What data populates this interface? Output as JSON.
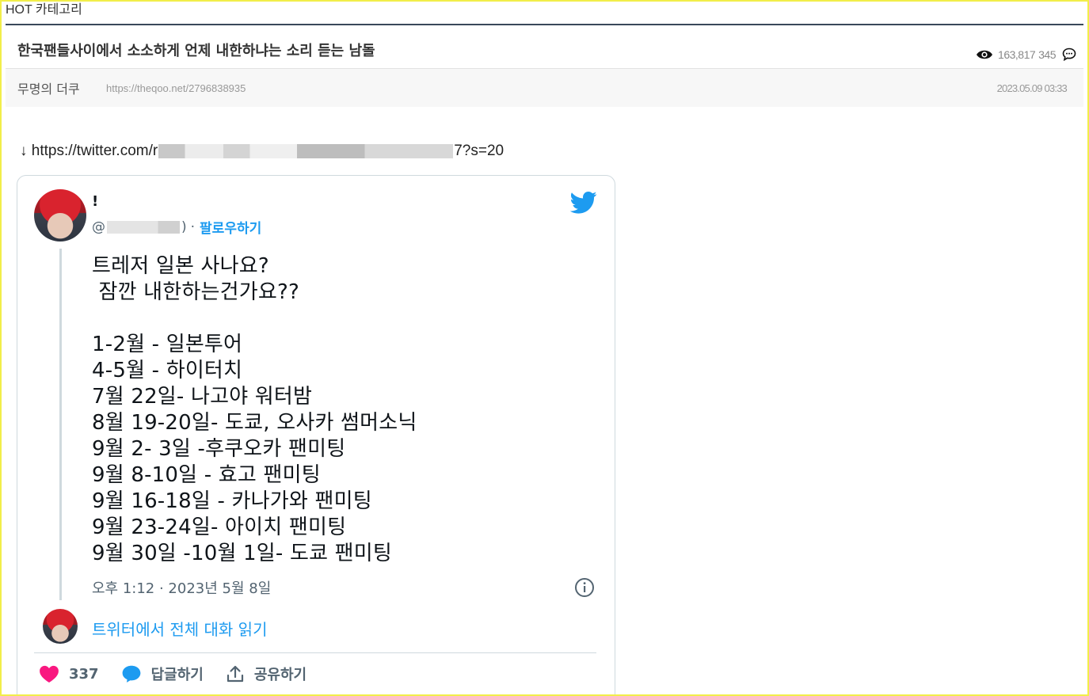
{
  "board": {
    "category": "HOT 카테고리",
    "post_title": "한국팬들사이에서 소소하게 언제 내한하냐는 소리 듣는 남돌",
    "views": "163,817",
    "comments": "345",
    "author": "무명의 더쿠",
    "post_url": "https://theqoo.net/2796838935",
    "date": "2023.05.09 03:33"
  },
  "source_link": {
    "prefix": "↓ https://twitter.com/r",
    "suffix": "7?s=20"
  },
  "tweet": {
    "display_name": "!",
    "handle_prefix": "@",
    "handle_suffix": ")",
    "separator": "·",
    "follow_label": "팔로우하기",
    "body": "트레저 일본 사나요?\n 잠깐 내한하는건가요??\n\n1-2월 - 일본투어\n4-5월 - 하이터치\n7월 22일- 나고야 워터밤\n8월 19-20일- 도쿄, 오사카 썸머소닉\n9월 2- 3일 -후쿠오카 팬미팅\n9월 8-10일 - 효고 팬미팅\n9월 16-18일 - 카나가와 팬미팅\n9월 23-24일- 아이치 팬미팅\n9월 30일 -10월 1일- 도쿄 팬미팅",
    "time": "오후 1:12 · 2023년 5월 8일",
    "read_conversation": "트위터에서 전체 대화 읽기",
    "like_count": "337",
    "reply_label": "답글하기",
    "share_label": "공유하기"
  },
  "colors": {
    "twitter_blue": "#1d9bf0",
    "like_pink": "#f91880",
    "frame_yellow": "#f2ee4a",
    "header_rule": "#39495a"
  },
  "icons": [
    "eye-icon",
    "comment-icon",
    "twitter-bird-icon",
    "info-icon",
    "heart-icon",
    "reply-icon",
    "share-icon"
  ]
}
